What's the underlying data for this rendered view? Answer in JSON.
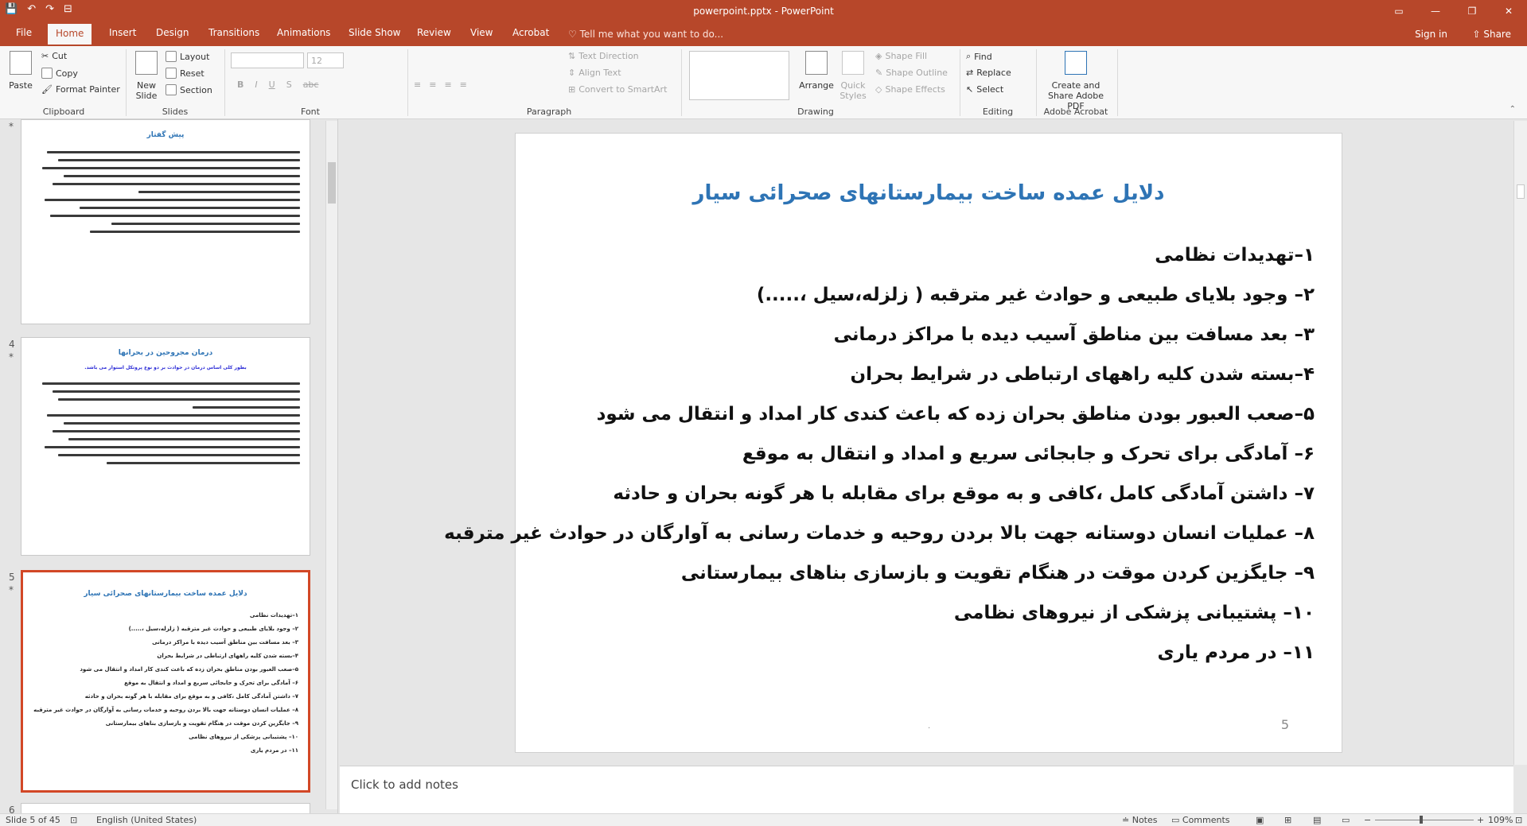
{
  "titlebar": {
    "title": "powerpoint.pptx - PowerPoint",
    "qat": [
      "💾",
      "↶",
      "↷",
      "⊟"
    ],
    "win": [
      "▭",
      "—",
      "❐",
      "✕"
    ]
  },
  "tabs": {
    "items": [
      "File",
      "Home",
      "Insert",
      "Design",
      "Transitions",
      "Animations",
      "Slide Show",
      "Review",
      "View",
      "Acrobat"
    ],
    "active": "Home",
    "tell": "Tell me what you want to do...",
    "signin": "Sign in",
    "share": "Share"
  },
  "ribbon": {
    "clipboard": {
      "label": "Clipboard",
      "paste": "Paste",
      "cut": "Cut",
      "copy": "Copy",
      "format_painter": "Format Painter"
    },
    "slides": {
      "label": "Slides",
      "new_slide": "New Slide",
      "layout": "Layout",
      "reset": "Reset",
      "section": "Section"
    },
    "font": {
      "label": "Font",
      "size": "12",
      "bold": "B",
      "italic": "I",
      "underline": "U",
      "shadow": "S",
      "strike": "abc"
    },
    "paragraph": {
      "label": "Paragraph",
      "text_direction": "Text Direction",
      "align_text": "Align Text",
      "smartart": "Convert to SmartArt"
    },
    "drawing": {
      "label": "Drawing",
      "arrange": "Arrange",
      "quick_styles": "Quick Styles",
      "shape_fill": "Shape Fill",
      "shape_outline": "Shape Outline",
      "shape_effects": "Shape Effects"
    },
    "editing": {
      "label": "Editing",
      "find": "Find",
      "replace": "Replace",
      "select": "Select"
    },
    "acrobat": {
      "label": "Adobe Acrobat",
      "create_share": "Create and Share Adobe PDF"
    }
  },
  "panel": {
    "slides": [
      {
        "num": "",
        "title": "پیش گفتار"
      },
      {
        "num": "4",
        "title": "درمان مجروحین در بحرانها",
        "subtitle": "بطور کلی اساس درمان در حوادث بر دو نوع پروتکل استوار می باشد."
      },
      {
        "num": "5",
        "title": "دلایل عمده ساخت بیمارستانهای صحرائی سیار"
      },
      {
        "num": "6"
      }
    ]
  },
  "slide": {
    "title": "دلایل عمده ساخت بیمارستانهای صحرائی سیار",
    "items": [
      "۱–تهدیدات نظامی",
      "۲– وجود بلایای طبیعی و حوادث غیر مترقبه ( زلزله،سیل ،.....)",
      "۳– بعد مسافت بین مناطق آسیب دیده با مراکز درمانی",
      "۴–بسته شدن کلیه راههای ارتباطی در شرایط بحران",
      "۵–صعب العبور بودن مناطق بحران زده که باعث کندی کار امداد و انتقال می شود",
      "۶– آمادگی برای تحرک و جابجائی سریع و امداد و انتقال به موقع",
      "۷– داشتن آمادگی کامل ،کافی و به موقع برای مقابله با هر گونه بحران و حادثه",
      "۸– عملیات انسان دوستانه جهت بالا بردن روحیه و خدمات رسانی به آوارگان در حوادث غیر مترقبه",
      "۹– جایگزین کردن موقت در هنگام تقویت و بازسازی بناهای بیمارستانی",
      "۱۰– پشتیبانی پزشکی از نیروهای نظامی",
      "۱۱– در مردم یاری"
    ],
    "number": "5",
    "dot": "."
  },
  "notes": {
    "placeholder": "Click to add notes"
  },
  "status": {
    "slide": "Slide 5 of 45",
    "language": "English (United States)",
    "notes": "Notes",
    "comments": "Comments",
    "zoom": "109%"
  },
  "colors": {
    "accent": "#b7472a",
    "selection": "#d24726",
    "title_blue": "#2e74b5"
  }
}
